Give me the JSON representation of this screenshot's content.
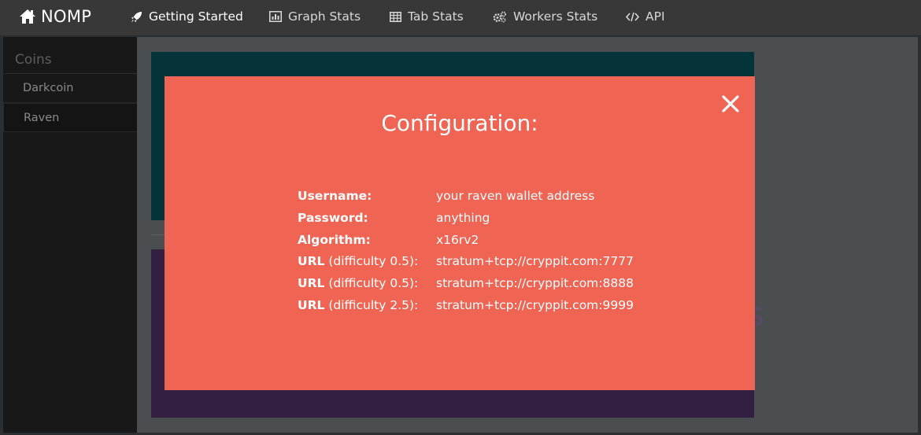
{
  "nav": {
    "brand": "NOMP",
    "items": [
      {
        "label": "Getting Started",
        "icon": "rocket-icon",
        "active": true
      },
      {
        "label": "Graph Stats",
        "icon": "bar-chart-icon"
      },
      {
        "label": "Tab Stats",
        "icon": "table-icon"
      },
      {
        "label": "Workers Stats",
        "icon": "gears-icon"
      },
      {
        "label": "API",
        "icon": "code-icon"
      }
    ]
  },
  "sidebar": {
    "heading": "Coins",
    "coins": [
      {
        "label": "Darkcoin"
      },
      {
        "label": "Raven",
        "active": true
      }
    ]
  },
  "background": {
    "partial_text": "s"
  },
  "modal": {
    "title": "Configuration:",
    "rows": [
      {
        "label_bold": "Username:",
        "label_rest": "",
        "value": "your raven wallet address"
      },
      {
        "label_bold": "Password:",
        "label_rest": "",
        "value": "anything"
      },
      {
        "label_bold": "Algorithm:",
        "label_rest": "",
        "value": "x16rv2"
      },
      {
        "label_bold": "URL",
        "label_rest": " (difficulty 0.5):",
        "value": "stratum+tcp://cryppit.com:7777"
      },
      {
        "label_bold": "URL",
        "label_rest": " (difficulty 0.5):",
        "value": "stratum+tcp://cryppit.com:8888"
      },
      {
        "label_bold": "URL",
        "label_rest": " (difficulty 2.5):",
        "value": "stratum+tcp://cryppit.com:9999"
      }
    ]
  },
  "colors": {
    "modal_bg": "#f06453",
    "panel_teal": "#043339",
    "panel_purple": "#321f42",
    "nav_bg": "#383838"
  }
}
